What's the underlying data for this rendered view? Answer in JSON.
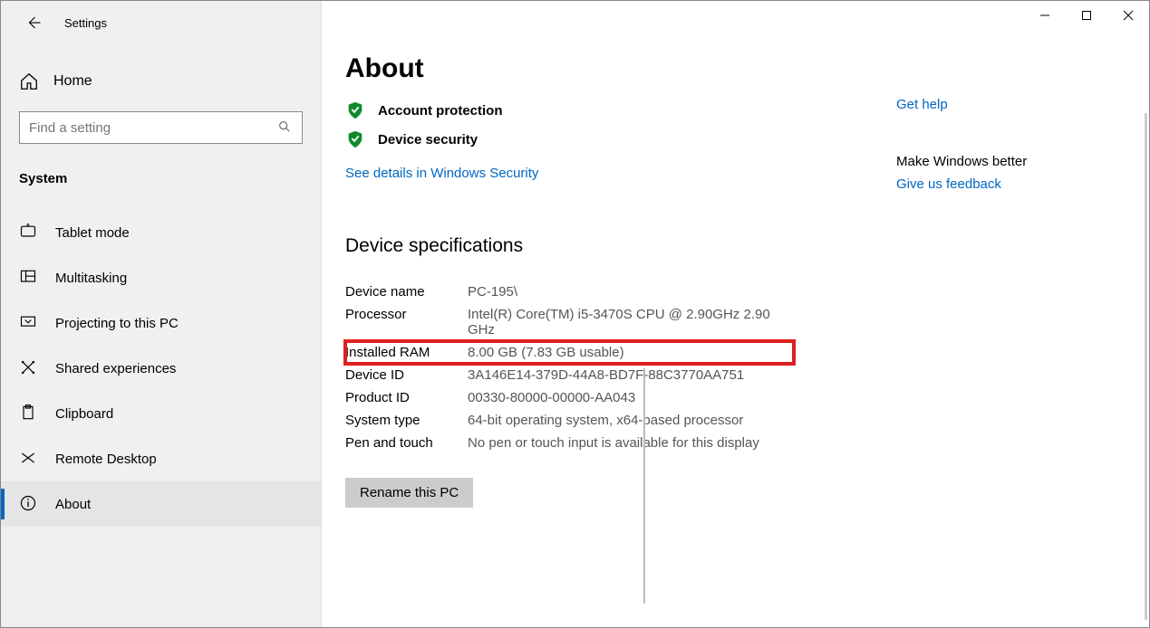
{
  "window": {
    "app_title": "Settings",
    "minimize": "–",
    "maximize": "▢",
    "close": "✕"
  },
  "sidebar": {
    "home_label": "Home",
    "search_placeholder": "Find a setting",
    "category": "System",
    "items": [
      {
        "label": "Tablet mode",
        "icon": "tablet"
      },
      {
        "label": "Multitasking",
        "icon": "multitask"
      },
      {
        "label": "Projecting to this PC",
        "icon": "project"
      },
      {
        "label": "Shared experiences",
        "icon": "share"
      },
      {
        "label": "Clipboard",
        "icon": "clipboard"
      },
      {
        "label": "Remote Desktop",
        "icon": "remote"
      },
      {
        "label": "About",
        "icon": "info",
        "selected": true
      }
    ]
  },
  "main": {
    "title": "About",
    "security_items": [
      "Account protection",
      "Device security"
    ],
    "security_link": "See details in Windows Security",
    "spec_heading": "Device specifications",
    "specs": [
      {
        "key": "Device name",
        "val": "PC-195\\"
      },
      {
        "key": "Processor",
        "val": "Intel(R) Core(TM) i5-3470S CPU @ 2.90GHz   2.90 GHz"
      },
      {
        "key": "Installed RAM",
        "val": "8.00 GB (7.83 GB usable)",
        "highlight": true
      },
      {
        "key": "Device ID",
        "val": "3A146E14-379D-44A8-BD7F-88C3770AA751"
      },
      {
        "key": "Product ID",
        "val": "00330-80000-00000-AA043"
      },
      {
        "key": "System type",
        "val": "64-bit operating system, x64-based processor"
      },
      {
        "key": "Pen and touch",
        "val": "No pen or touch input is available for this display"
      }
    ],
    "rename_btn": "Rename this PC"
  },
  "right": {
    "get_help": "Get help",
    "better_head": "Make Windows better",
    "feedback": "Give us feedback"
  }
}
